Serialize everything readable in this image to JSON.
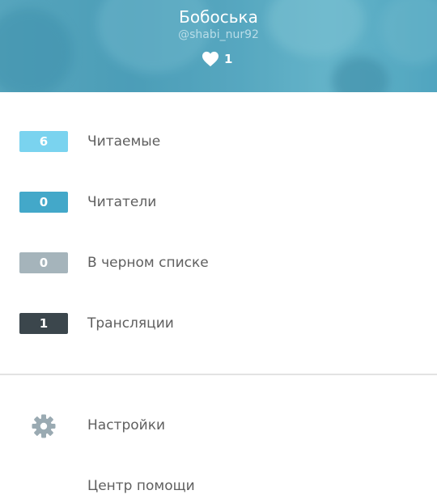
{
  "profile": {
    "name": "Бобоська",
    "handle": "@shabi_nur92",
    "likes": "1"
  },
  "stats": [
    {
      "count": "6",
      "label": "Читаемые",
      "color": "#7ad3ef"
    },
    {
      "count": "0",
      "label": "Читатели",
      "color": "#43a8c9"
    },
    {
      "count": "0",
      "label": "В черном списке",
      "color": "#a5b4bb"
    },
    {
      "count": "1",
      "label": "Трансляции",
      "color": "#3b464c"
    }
  ],
  "menu": [
    {
      "label": "Настройки",
      "icon": "gear-icon"
    },
    {
      "label": "Центр помощи",
      "icon": ""
    }
  ]
}
